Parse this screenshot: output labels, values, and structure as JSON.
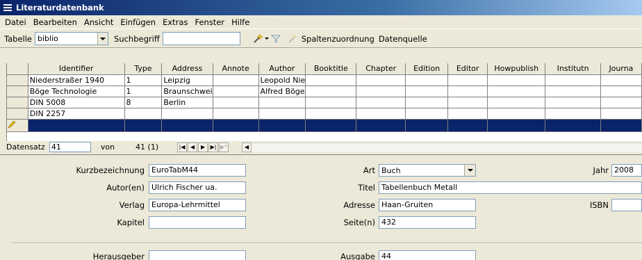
{
  "window": {
    "title": "Literaturdatenbank"
  },
  "menu": [
    "Datei",
    "Bearbeiten",
    "Ansicht",
    "Einfügen",
    "Extras",
    "Fenster",
    "Hilfe"
  ],
  "toolbar": {
    "table_label": "Tabelle",
    "table_value": "biblio",
    "search_label": "Suchbegriff",
    "search_value": "",
    "column_assign": "Spaltenzuordnung",
    "datasource": "Datenquelle"
  },
  "grid": {
    "columns": [
      "Identifier",
      "Type",
      "Address",
      "Annote",
      "Author",
      "Booktitle",
      "Chapter",
      "Edition",
      "Editor",
      "Howpublish",
      "Institutn",
      "Journa"
    ],
    "rows": [
      [
        "Niederstraßer 1940",
        "1",
        "Leipzig",
        "",
        "Leopold Nie",
        "",
        "",
        "",
        "",
        "",
        "",
        ""
      ],
      [
        "Böge Technologie",
        "1",
        "Braunschwei",
        "",
        "Alfred Böge",
        "",
        "",
        "",
        "",
        "",
        "",
        ""
      ],
      [
        "DIN 5008",
        "8",
        "Berlin",
        "",
        "",
        "",
        "",
        "",
        "",
        "",
        "",
        ""
      ],
      [
        "DIN 2257",
        "",
        "",
        "",
        "",
        "",
        "",
        "",
        "",
        "",
        "",
        ""
      ],
      [
        "",
        "",
        "",
        "",
        "",
        "",
        "",
        "",
        "",
        "",
        "",
        ""
      ]
    ]
  },
  "navigator": {
    "record_label": "Datensatz",
    "record_value": "41",
    "of_label": "von",
    "total": "41 (1)"
  },
  "form": {
    "kurz_label": "Kurzbezeichnung",
    "kurz_value": "EuroTabM44",
    "autor_label": "Autor(en)",
    "autor_value": "Ulrich Fischer ua.",
    "verlag_label": "Verlag",
    "verlag_value": "Europa-Lehrmittel",
    "kapitel_label": "Kapitel",
    "kapitel_value": "",
    "art_label": "Art",
    "art_value": "Buch",
    "titel_label": "Titel",
    "titel_value": "Tabellenbuch Metall",
    "adresse_label": "Adresse",
    "adresse_value": "Haan-Gruiten",
    "seiten_label": "Seite(n)",
    "seiten_value": "432",
    "jahr_label": "Jahr",
    "jahr_value": "2008",
    "isbn_label": "ISBN",
    "isbn_value": "",
    "herausgeber_label": "Herausgeber",
    "herausgeber_value": "",
    "ausgabe_label": "Ausgabe",
    "ausgabe_value": "44"
  },
  "colors": {
    "title_start": "#0a246a",
    "title_end": "#a6caf0",
    "selection": "#0a246a"
  }
}
